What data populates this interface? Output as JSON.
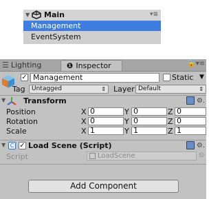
{
  "hierarchy": {
    "scene_name": "Main",
    "items": [
      {
        "label": "Management",
        "selected": true
      },
      {
        "label": "EventSystem",
        "selected": false
      }
    ]
  },
  "tabs": {
    "lighting": "Lighting",
    "inspector": "Inspector"
  },
  "gameobject": {
    "name": "Management",
    "active": true,
    "static_label": "Static",
    "tag_label": "Tag",
    "tag_value": "Untagged",
    "layer_label": "Layer",
    "layer_value": "Default"
  },
  "transform": {
    "title": "Transform",
    "position": {
      "label": "Position",
      "x": "0",
      "y": "0",
      "z": "0"
    },
    "rotation": {
      "label": "Rotation",
      "x": "0",
      "y": "0",
      "z": "0"
    },
    "scale": {
      "label": "Scale",
      "x": "1",
      "y": "1",
      "z": "1"
    }
  },
  "axes": {
    "x": "X",
    "y": "Y",
    "z": "Z"
  },
  "script_component": {
    "title": "Load Scene (Script)",
    "enabled": true,
    "script_label": "Script",
    "script_value": "LoadScene"
  },
  "add_component_label": "Add Component",
  "colors": {
    "selection": "#3e7de0",
    "panel": "#c2c2c2",
    "tabbar": "#a5a5a5"
  }
}
